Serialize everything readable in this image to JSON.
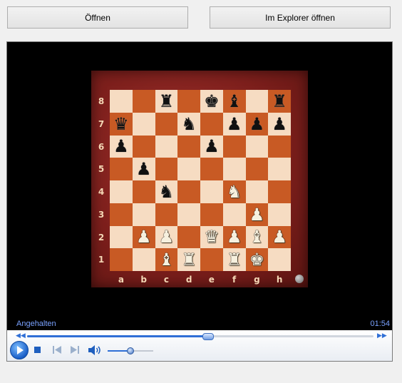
{
  "toolbar": {
    "open_label": "Öffnen",
    "explorer_label": "Im Explorer öffnen"
  },
  "player": {
    "status": "Angehalten",
    "time": "01:54",
    "seek_progress_percent": 52,
    "volume_percent": 50
  },
  "board": {
    "ranks": [
      "8",
      "7",
      "6",
      "5",
      "4",
      "3",
      "2",
      "1"
    ],
    "files": [
      "a",
      "b",
      "c",
      "d",
      "e",
      "f",
      "g",
      "h"
    ],
    "rows": [
      [
        "",
        "",
        "r",
        "",
        "k",
        "b",
        "",
        "r"
      ],
      [
        "q",
        "",
        "",
        "n",
        "",
        "p",
        "p",
        "p"
      ],
      [
        "p",
        "",
        "",
        "",
        "p",
        "",
        "",
        ""
      ],
      [
        "",
        "p",
        "",
        "",
        "",
        "",
        "",
        ""
      ],
      [
        "",
        "",
        "n",
        "",
        "",
        "N",
        "",
        ""
      ],
      [
        "",
        "",
        "",
        "",
        "",
        "",
        "P",
        ""
      ],
      [
        "",
        "P",
        "P",
        "",
        "Q",
        "P",
        "B",
        "P"
      ],
      [
        "",
        "",
        "B",
        "R",
        "",
        "R",
        "K",
        ""
      ]
    ]
  },
  "colors": {
    "accent": "#2f6fd6",
    "status_text": "#7aa2ff",
    "light_square": "#f6dcc2",
    "dark_square": "#c85a24",
    "board_frame": "#7d1f1c"
  }
}
